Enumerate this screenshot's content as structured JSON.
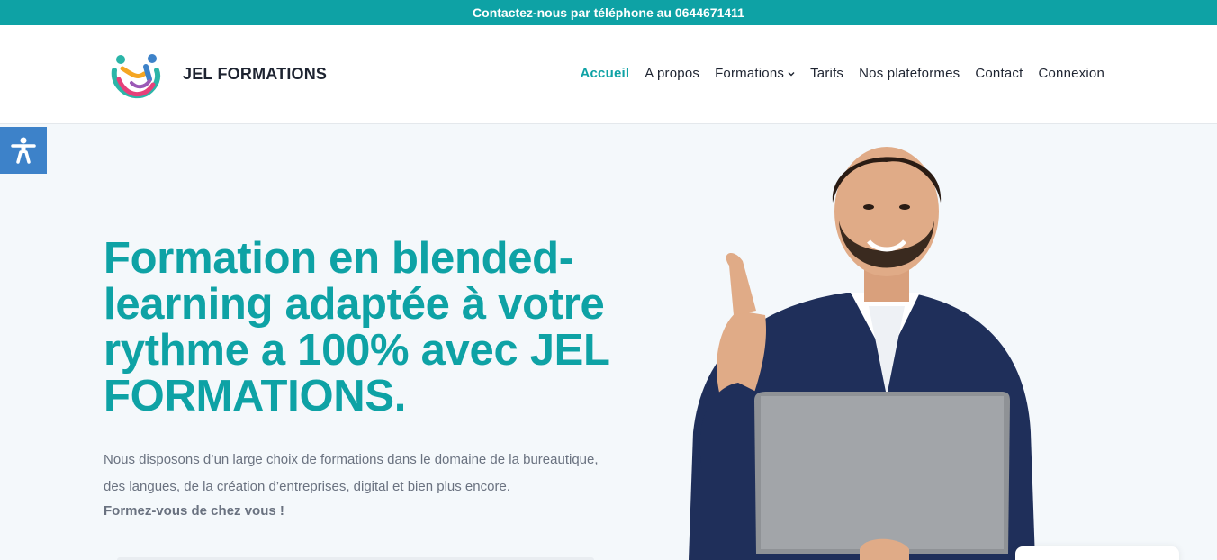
{
  "topbar": {
    "text": "Contactez-nous par téléphone au 0644671411"
  },
  "header": {
    "brand": "JEL FORMATIONS",
    "nav": [
      {
        "label": "Accueil",
        "active": true
      },
      {
        "label": "A propos"
      },
      {
        "label": "Formations",
        "has_dropdown": true
      },
      {
        "label": "Tarifs"
      },
      {
        "label": "Nos plateformes"
      },
      {
        "label": "Contact"
      },
      {
        "label": "Connexion"
      }
    ]
  },
  "accessibility": {
    "icon": "accessibility-icon"
  },
  "hero": {
    "title": "Formation en blended-learning adaptée à votre rythme a 100% avec JEL FORMATIONS.",
    "description": "Nous disposons d’un large choix de formations dans le domaine de la bureautique, des langues, de la création d’entreprises, digital et bien plus encore.",
    "cta": "Formez-vous de chez vous !"
  },
  "colors": {
    "accent": "#0ea2a5",
    "topbar": "#0ea2a5",
    "accessibility_button": "#3d82c9",
    "text_dark": "#1d2330",
    "text_muted": "#6a7280",
    "page_bg": "#f4f8fb"
  }
}
